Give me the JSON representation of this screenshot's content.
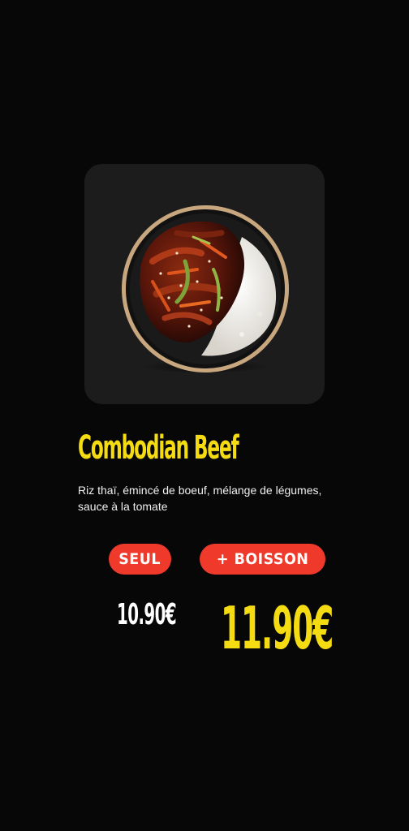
{
  "product": {
    "name": "Combodian Beef",
    "description": "Riz thaï, émincé de boeuf, mélange de légumes, sauce à la tomate",
    "image_icon": "rice-bowl-image"
  },
  "options": {
    "solo_label": "SEUL",
    "combo_label": "+ BOISSON"
  },
  "prices": {
    "solo": "10.90€",
    "combo": "11.90€"
  },
  "colors": {
    "background": "#070707",
    "card": "#1c1c1c",
    "accent_yellow": "#f5dc12",
    "accent_red": "#ef3a2b"
  }
}
